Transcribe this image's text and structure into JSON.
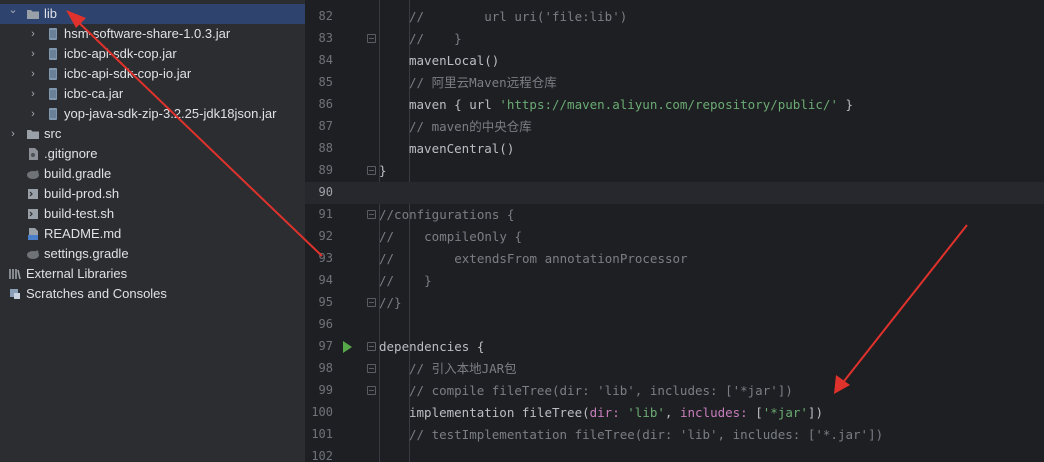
{
  "project_tree": {
    "items": [
      {
        "label": "lib",
        "icon": "folder-icon",
        "chevron": "down",
        "selected": true
      },
      {
        "label": "hsm-software-share-1.0.3.jar",
        "icon": "jar-icon",
        "chevron": "right"
      },
      {
        "label": "icbc-api-sdk-cop.jar",
        "icon": "jar-icon",
        "chevron": "right"
      },
      {
        "label": "icbc-api-sdk-cop-io.jar",
        "icon": "jar-icon",
        "chevron": "right"
      },
      {
        "label": "icbc-ca.jar",
        "icon": "jar-icon",
        "chevron": "right"
      },
      {
        "label": "yop-java-sdk-zip-3.2.25-jdk18json.jar",
        "icon": "jar-icon",
        "chevron": "right"
      },
      {
        "label": "src",
        "icon": "folder-icon",
        "chevron": "right"
      },
      {
        "label": ".gitignore",
        "icon": "gitignore-file-icon",
        "chevron": ""
      },
      {
        "label": "build.gradle",
        "icon": "gradle-file-icon",
        "chevron": ""
      },
      {
        "label": "build-prod.sh",
        "icon": "shell-script-icon",
        "chevron": ""
      },
      {
        "label": "build-test.sh",
        "icon": "shell-script-icon",
        "chevron": ""
      },
      {
        "label": "README.md",
        "icon": "markdown-file-icon",
        "chevron": ""
      },
      {
        "label": "settings.gradle",
        "icon": "gradle-file-icon",
        "chevron": ""
      },
      {
        "label": "External Libraries",
        "icon": "libraries-icon",
        "chevron": "right"
      },
      {
        "label": "Scratches and Consoles",
        "icon": "scratches-icon",
        "chevron": "right"
      }
    ]
  },
  "editor": {
    "lines": [
      {
        "num": "82",
        "tokens": [
          {
            "t": "//        url uri('file:lib')",
            "c": "cmt"
          }
        ]
      },
      {
        "num": "83",
        "fold": true,
        "tokens": [
          {
            "t": "//    }",
            "c": "cmt"
          }
        ]
      },
      {
        "num": "84",
        "tokens": [
          {
            "t": "mavenLocal()",
            "c": "plain"
          }
        ]
      },
      {
        "num": "85",
        "tokens": [
          {
            "t": "// 阿里云Maven远程仓库",
            "c": "cmt"
          }
        ]
      },
      {
        "num": "86",
        "tokens": [
          {
            "t": "maven { url ",
            "c": "plain"
          },
          {
            "t": "'https://maven.aliyun.com/repository/public/'",
            "c": "str"
          },
          {
            "t": " }",
            "c": "plain"
          }
        ]
      },
      {
        "num": "87",
        "tokens": [
          {
            "t": "// maven的中央仓库",
            "c": "cmt"
          }
        ]
      },
      {
        "num": "88",
        "tokens": [
          {
            "t": "mavenCentral()",
            "c": "plain"
          }
        ]
      },
      {
        "num": "89",
        "fold": true,
        "tokens": [
          {
            "t": "}",
            "c": "plain"
          }
        ]
      },
      {
        "num": "90",
        "current": true,
        "tokens": []
      },
      {
        "num": "91",
        "fold": true,
        "tokens": [
          {
            "t": "//configurations {",
            "c": "cmt"
          }
        ]
      },
      {
        "num": "92",
        "tokens": [
          {
            "t": "//    compileOnly {",
            "c": "cmt"
          }
        ]
      },
      {
        "num": "93",
        "tokens": [
          {
            "t": "//        extendsFrom annotationProcessor",
            "c": "cmt"
          }
        ]
      },
      {
        "num": "94",
        "tokens": [
          {
            "t": "//    }",
            "c": "cmt"
          }
        ]
      },
      {
        "num": "95",
        "fold": true,
        "tokens": [
          {
            "t": "//}",
            "c": "cmt"
          }
        ]
      },
      {
        "num": "96",
        "tokens": []
      },
      {
        "num": "97",
        "run": true,
        "fold": true,
        "tokens": [
          {
            "t": "dependencies {",
            "c": "plain"
          }
        ]
      },
      {
        "num": "98",
        "fold": true,
        "tokens": [
          {
            "t": "// 引入本地JAR包",
            "c": "cmt"
          }
        ]
      },
      {
        "num": "99",
        "fold": true,
        "tokens": [
          {
            "t": "// compile fileTree(dir: 'lib', includes: ['*jar'])",
            "c": "cmt"
          }
        ]
      },
      {
        "num": "100",
        "tokens": [
          {
            "t": "implementation fileTree(",
            "c": "plain"
          },
          {
            "t": "dir: ",
            "c": "arg"
          },
          {
            "t": "'lib'",
            "c": "str"
          },
          {
            "t": ", ",
            "c": "plain"
          },
          {
            "t": "includes: ",
            "c": "arg"
          },
          {
            "t": "[",
            "c": "plain"
          },
          {
            "t": "'*jar'",
            "c": "str"
          },
          {
            "t": "])",
            "c": "plain"
          }
        ]
      },
      {
        "num": "101",
        "tokens": [
          {
            "t": "// testImplementation fileTree(dir: 'lib', includes: ['*.jar'])",
            "c": "cmt"
          }
        ]
      },
      {
        "num": "102",
        "tokens": []
      }
    ]
  },
  "colors": {
    "sidebar_bg": "#2b2d30",
    "editor_bg": "#1e1f22",
    "selection": "#2e436e",
    "arrow": "#e0322c",
    "string": "#6aab73",
    "comment": "#7a7e85",
    "named_arg": "#c77dbb"
  }
}
